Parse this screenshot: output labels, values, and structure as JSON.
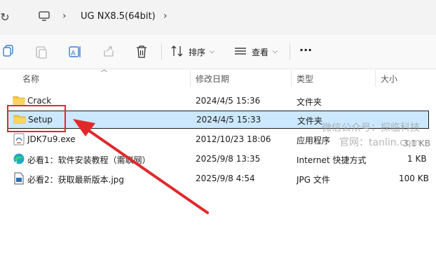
{
  "address": {
    "crumb": "UG NX8.5(64bit)"
  },
  "toolbar": {
    "sort_label": "排序",
    "view_label": "查看",
    "more_label": "···"
  },
  "columns": {
    "name": "名称",
    "modified": "修改日期",
    "type": "类型",
    "size": "大小"
  },
  "files": [
    {
      "name": "Crack",
      "modified": "2024/4/5 15:36",
      "type": "文件夹",
      "size": "",
      "icon": "folder-icon"
    },
    {
      "name": "Setup",
      "modified": "2024/4/5 15:33",
      "type": "文件夹",
      "size": "",
      "icon": "folder-icon"
    },
    {
      "name": "JDK7u9.exe",
      "modified": "2012/10/23 18:06",
      "type": "应用程序",
      "size": "",
      "icon": "exe-icon"
    },
    {
      "name": "必看1：软件安装教程（需联网）",
      "modified": "2025/9/8 13:35",
      "type": "Internet 快捷方式",
      "size": "1 KB",
      "icon": "internet-shortcut-icon"
    },
    {
      "name": "必看2：获取最新版本.jpg",
      "modified": "2025/9/8 4:54",
      "type": "JPG 文件",
      "size": "100 KB",
      "icon": "jpg-file-icon"
    }
  ],
  "watermark": {
    "line1": "微信公众号：探临科技",
    "line2": "官网：tanlin.com",
    "size_partial": "3,1 KB"
  },
  "accent": "#cce8ff",
  "annotation_color": "#e0292b"
}
